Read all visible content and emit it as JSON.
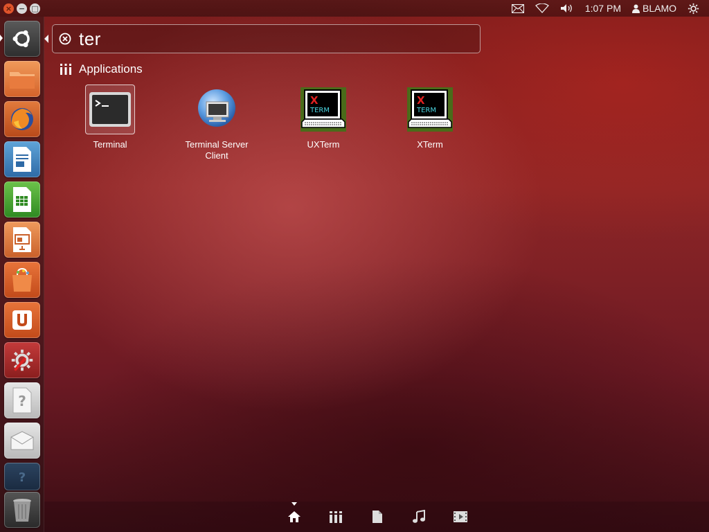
{
  "window_controls": {
    "close": "×",
    "minimize": "−",
    "maximize": "□"
  },
  "top_panel": {
    "icons": [
      "mail-icon",
      "wifi-icon",
      "volume-icon"
    ],
    "clock": "1:07 PM",
    "user": "BLAMO",
    "settings_icon": "gear-icon"
  },
  "launcher": {
    "items": [
      {
        "name": "ubuntu-dash",
        "icon": "ubuntu-logo-icon"
      },
      {
        "name": "files",
        "icon": "folder-icon"
      },
      {
        "name": "firefox",
        "icon": "firefox-icon"
      },
      {
        "name": "libreoffice-writer",
        "icon": "writer-icon"
      },
      {
        "name": "libreoffice-calc",
        "icon": "calc-icon"
      },
      {
        "name": "libreoffice-impress",
        "icon": "impress-icon"
      },
      {
        "name": "ubuntu-software-center",
        "icon": "software-center-icon"
      },
      {
        "name": "ubuntu-one",
        "icon": "ubuntu-one-icon"
      },
      {
        "name": "system-settings",
        "icon": "settings-icon"
      },
      {
        "name": "unknown-app",
        "icon": "question-icon"
      },
      {
        "name": "mail-app",
        "icon": "envelope-icon"
      },
      {
        "name": "unknown-app-2",
        "icon": "question-icon"
      },
      {
        "name": "trash",
        "icon": "trash-icon"
      }
    ]
  },
  "dash": {
    "search_query": "ter",
    "category": "Applications",
    "apps": [
      {
        "label": "Terminal",
        "icon": "terminal-icon",
        "selected": true
      },
      {
        "label": "Terminal Server Client",
        "icon": "remote-desktop-icon",
        "selected": false
      },
      {
        "label": "UXTerm",
        "icon": "xterm-icon",
        "selected": false
      },
      {
        "label": "XTerm",
        "icon": "xterm-icon",
        "selected": false
      }
    ],
    "xterm_glyph": "X",
    "xterm_word": "TERM"
  },
  "lenses": [
    "home-lens-icon",
    "applications-lens-icon",
    "files-lens-icon",
    "music-lens-icon",
    "video-lens-icon"
  ],
  "colors": {
    "accent": "#dd4814",
    "background": "#8e2626"
  }
}
